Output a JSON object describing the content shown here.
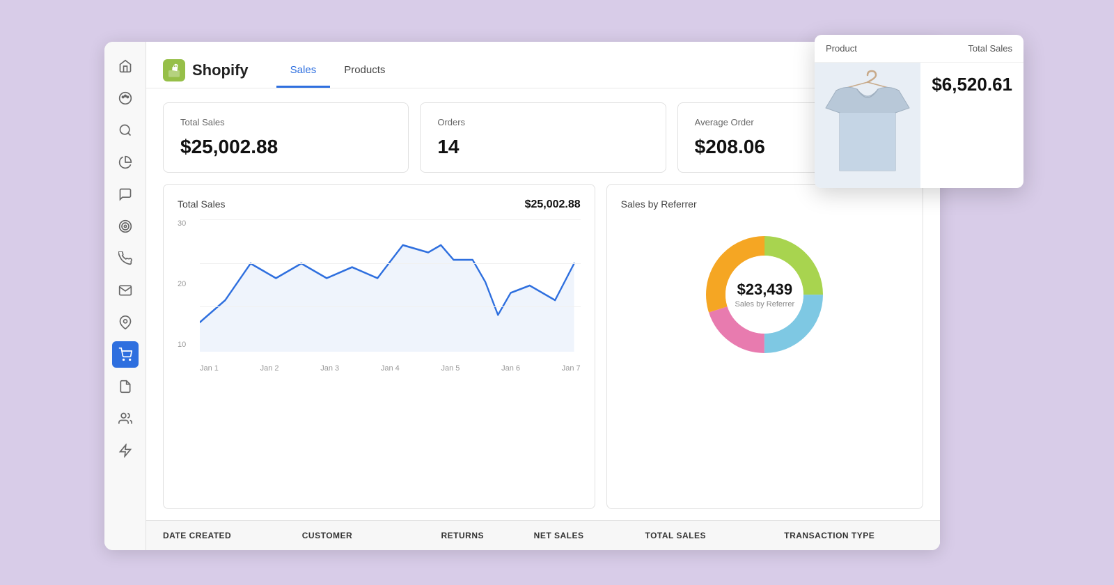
{
  "page": {
    "background": "#d8cce8"
  },
  "sidebar": {
    "icons": [
      {
        "name": "home-icon",
        "glyph": "⌂",
        "active": false
      },
      {
        "name": "palette-icon",
        "glyph": "🎨",
        "active": false
      },
      {
        "name": "search-icon",
        "glyph": "🔍",
        "active": false
      },
      {
        "name": "chart-icon",
        "glyph": "◕",
        "active": false
      },
      {
        "name": "message-icon",
        "glyph": "💬",
        "active": false
      },
      {
        "name": "target-icon",
        "glyph": "◎",
        "active": false
      },
      {
        "name": "phone-icon",
        "glyph": "📞",
        "active": false
      },
      {
        "name": "mail-icon",
        "glyph": "✉",
        "active": false
      },
      {
        "name": "location-icon",
        "glyph": "📍",
        "active": false
      },
      {
        "name": "cart-icon",
        "glyph": "🛒",
        "active": true
      },
      {
        "name": "file-icon",
        "glyph": "📄",
        "active": false
      },
      {
        "name": "users-icon",
        "glyph": "👥",
        "active": false
      },
      {
        "name": "plugin-icon",
        "glyph": "⚡",
        "active": false
      }
    ]
  },
  "header": {
    "logo_text": "Shopify",
    "tabs": [
      {
        "label": "Sales",
        "active": true
      },
      {
        "label": "Products",
        "active": false
      }
    ]
  },
  "metrics": [
    {
      "label": "Total Sales",
      "value": "$25,002.88"
    },
    {
      "label": "Orders",
      "value": "14"
    },
    {
      "label": "Average Order",
      "value": "$208.06"
    }
  ],
  "line_chart": {
    "title": "Total Sales",
    "total": "$25,002.88",
    "y_labels": [
      "30",
      "20",
      "10"
    ],
    "x_labels": [
      "Jan 1",
      "Jan 2",
      "Jan 3",
      "Jan 4",
      "Jan 5",
      "Jan 6",
      "Jan 7"
    ]
  },
  "donut_chart": {
    "title": "Sales by Referrer",
    "center_value": "$23,439",
    "center_label": "Sales by Referrer",
    "segments": [
      {
        "color": "#a8d44f",
        "value": 25
      },
      {
        "color": "#7ec8e3",
        "value": 25
      },
      {
        "color": "#e87baf",
        "value": 20
      },
      {
        "color": "#f5a623",
        "value": 30
      }
    ]
  },
  "table": {
    "columns": [
      {
        "label": "DATE CREATED",
        "key": "date"
      },
      {
        "label": "CUSTOMER",
        "key": "customer"
      },
      {
        "label": "RETURNS",
        "key": "returns"
      },
      {
        "label": "NET SALES",
        "key": "net_sales"
      },
      {
        "label": "TOTAL SALES",
        "key": "total_sales"
      },
      {
        "label": "TRANSACTION TYPE",
        "key": "transaction_type"
      }
    ]
  },
  "tooltip": {
    "product_label": "Product",
    "sales_label": "Total Sales",
    "sales_value": "$6,520.61"
  }
}
